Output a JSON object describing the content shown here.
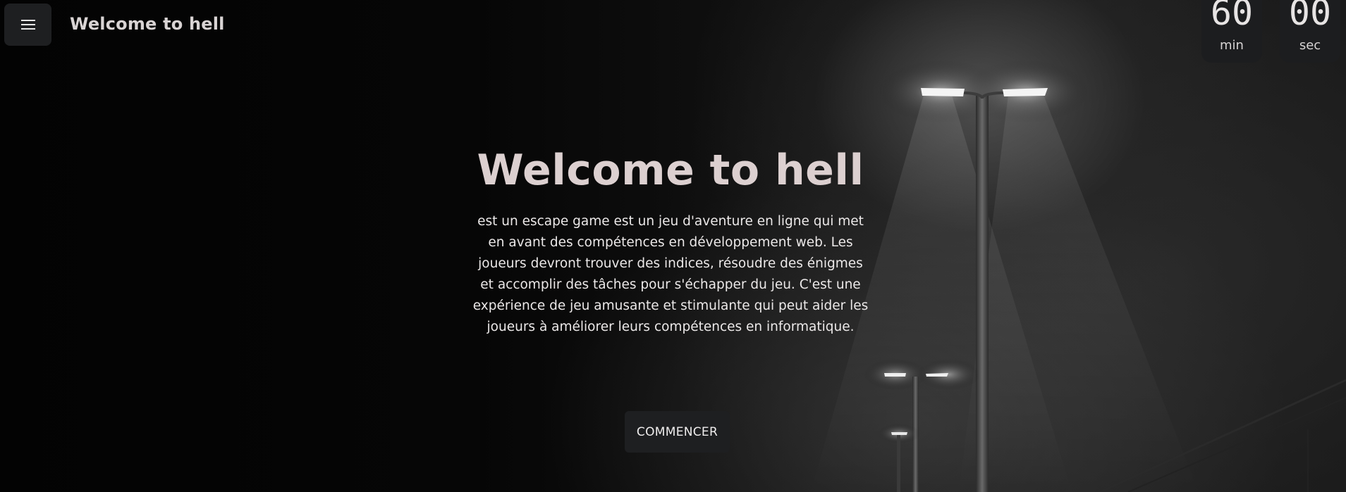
{
  "header": {
    "menu_icon": "hamburger-menu-icon",
    "title": "Welcome to hell"
  },
  "timer": {
    "minutes": "60",
    "minutes_unit": "min",
    "seconds": "00",
    "seconds_unit": "sec"
  },
  "hero": {
    "title": "Welcome to hell",
    "description": "est un escape game est un jeu d'aventure en ligne qui met en avant des compétences en développement web. Les joueurs devront trouver des indices, résoudre des énigmes et accomplir des tâches pour s'échapper du jeu. C'est une expérience de jeu amusante et stimulante qui peut aider les joueurs à améliorer leurs compétences en informatique.",
    "start_button": "COMMENCER"
  },
  "colors": {
    "button_bg": "#1e1f21",
    "title_text": "#dcd0d0",
    "body_text": "#ebe8e8"
  }
}
